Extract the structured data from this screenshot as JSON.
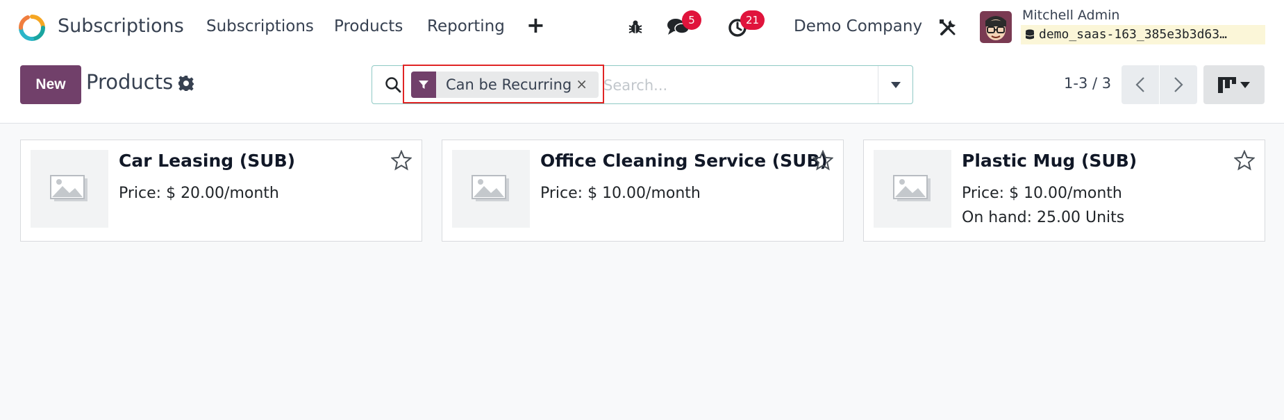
{
  "app": {
    "title": "Subscriptions",
    "brand_color": "#71406a"
  },
  "nav": {
    "menus": [
      "Subscriptions",
      "Products",
      "Reporting"
    ],
    "add_icon": "plus-icon",
    "messages_badge": "5",
    "activities_badge": "21",
    "company": "Demo Company",
    "user_name": "Mitchell Admin",
    "database": "demo_saas-163_385e3b3d63…"
  },
  "control": {
    "new_label": "New",
    "title": "Products",
    "facet_label": "Can be Recurring",
    "facet_close": "×",
    "search_placeholder": "Search...",
    "pager": "1-3 / 3"
  },
  "products": [
    {
      "name": "Car Leasing (SUB)",
      "price": "Price: $ 20.00/month",
      "extra": ""
    },
    {
      "name": "Office Cleaning Service (SUB)",
      "price": "Price: $ 10.00/month",
      "extra": ""
    },
    {
      "name": "Plastic Mug (SUB)",
      "price": "Price: $ 10.00/month",
      "extra": "On hand: 25.00 Units"
    }
  ]
}
